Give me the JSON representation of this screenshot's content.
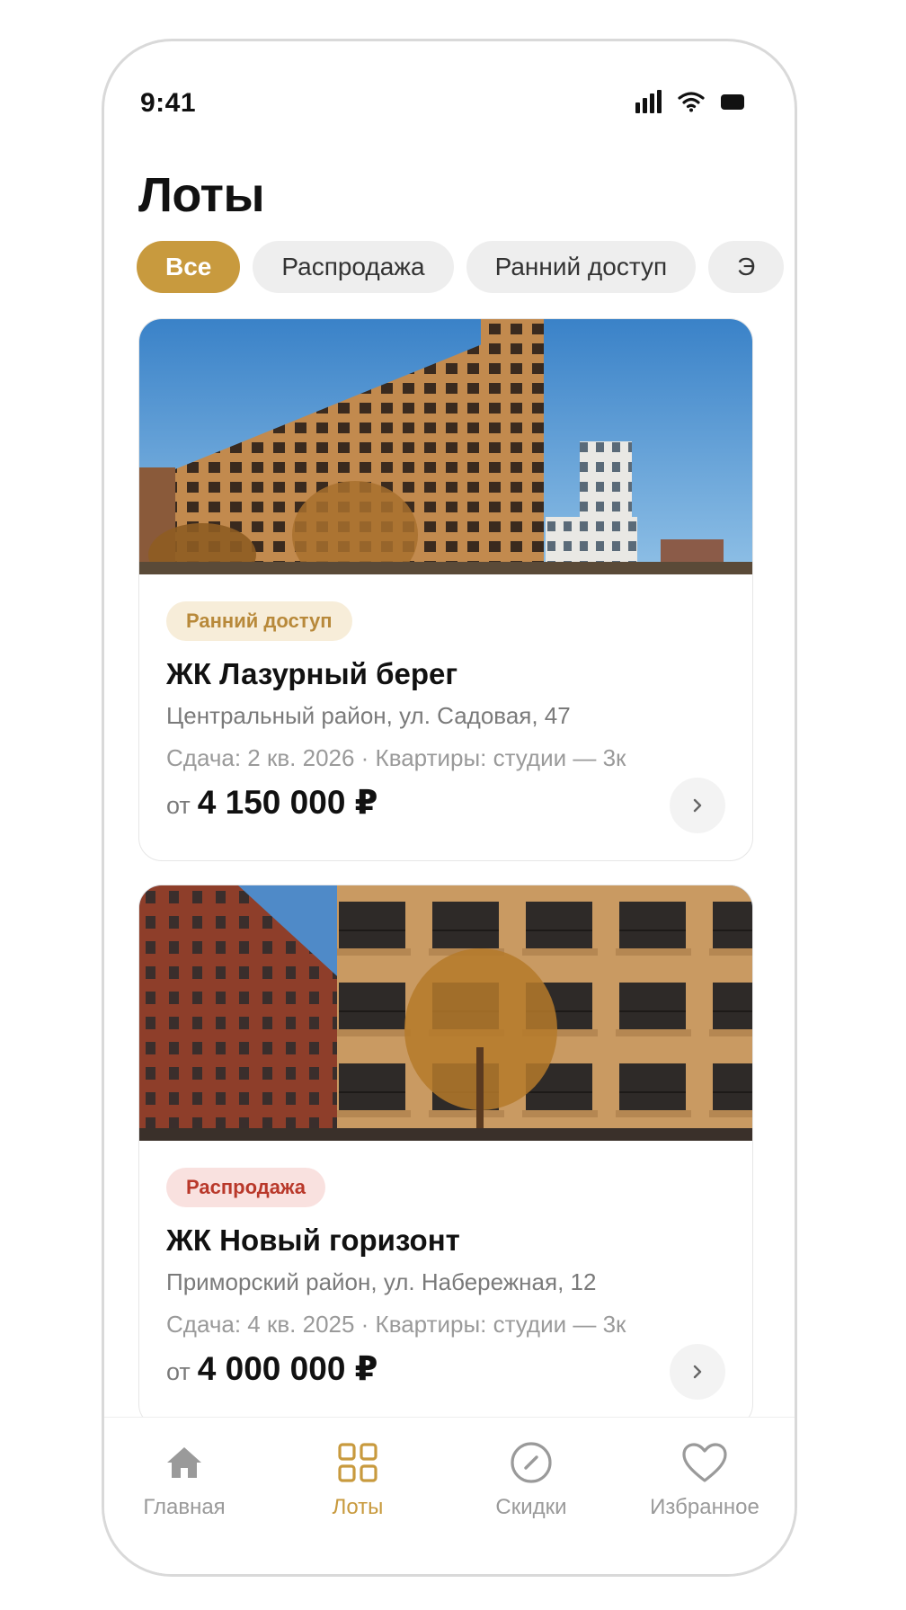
{
  "status_bar": {
    "time": "9:41"
  },
  "page": {
    "title": "Лоты"
  },
  "filters": [
    {
      "label": "Все",
      "active": true
    },
    {
      "label": "Распродажа",
      "active": false
    },
    {
      "label": "Ранний доступ",
      "active": false
    },
    {
      "label": "Э",
      "active": false
    }
  ],
  "lots": [
    {
      "tag": "Ранний доступ",
      "tag_kind": "early",
      "name": "ЖК Лазурный берег",
      "address": "Центральный район, ул. Садовая, 47",
      "meta": "Сдача: 2 кв. 2026 · Квартиры: студии — 3к",
      "price_prefix": "от",
      "price": "4 150 000 ₽"
    },
    {
      "tag": "Распродажа",
      "tag_kind": "sale",
      "name": "ЖК Новый горизонт",
      "address": "Приморский район, ул. Набережная, 12",
      "meta": "Сдача: 4 кв. 2025 · Квартиры: студии — 3к",
      "price_prefix": "от",
      "price": "4 000 000 ₽"
    }
  ],
  "tab_bar": {
    "tabs": [
      {
        "label": "Главная",
        "icon": "home-icon",
        "active": false
      },
      {
        "label": "Лоты",
        "icon": "grid-icon",
        "active": true
      },
      {
        "label": "Скидки",
        "icon": "compass-icon",
        "active": false
      },
      {
        "label": "Избранное",
        "icon": "heart-icon",
        "active": false
      }
    ]
  },
  "colors": {
    "accent": "#c89a3e",
    "chip_bg": "#eeeeee",
    "early_tag_bg": "#f7edd9",
    "sale_tag_bg": "#f9e1df",
    "sale_tag_text": "#b9382a"
  }
}
